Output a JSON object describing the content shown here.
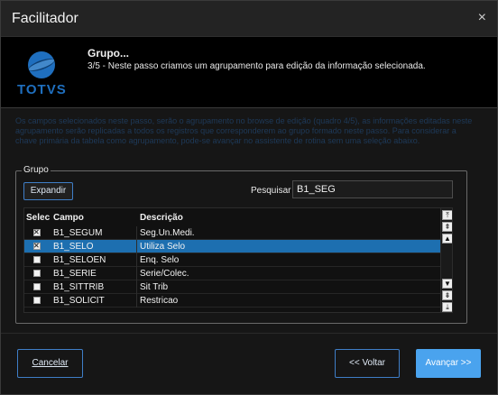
{
  "window": {
    "title": "Facilitador",
    "close_glyph": "×"
  },
  "header": {
    "logo_text": "TOTVS",
    "step_title": "Grupo...",
    "step_desc": "3/5 - Neste passo criamos um agrupamento para edição da informação selecionada."
  },
  "info_text": "Os campos selecionados neste passo, serão o agrupamento no browse de edição (quadro 4/5), as informações editadas neste agrupamento serão replicadas a todos os registros que corresponderem ao grupo formado neste passo. Para considerar a chave primária da tabela como agrupamento, pode-se avançar no assistente de rotina sem uma seleção abaixo.",
  "group": {
    "legend": "Grupo",
    "expand_label": "Expandir",
    "search_label": "Pesquisar",
    "search_value": "B1_SEG",
    "columns": {
      "select": "Selec",
      "field": "Campo",
      "description": "Descrição"
    },
    "rows": [
      {
        "checked": true,
        "field": "B1_SEGUM",
        "description": "Seg.Un.Medi."
      },
      {
        "checked": true,
        "field": "B1_SELO",
        "description": "Utiliza Selo"
      },
      {
        "checked": false,
        "field": "B1_SELOEN",
        "description": "Enq. Selo"
      },
      {
        "checked": false,
        "field": "B1_SERIE",
        "description": "Serie/Colec."
      },
      {
        "checked": false,
        "field": "B1_SITTRIB",
        "description": "Sit Trib"
      },
      {
        "checked": false,
        "field": "B1_SOLICIT",
        "description": "Restricao"
      }
    ],
    "selected_row": 1
  },
  "footer": {
    "cancel_label": "Cancelar",
    "back_label": "<< Voltar",
    "next_label": "Avançar >>"
  },
  "colors": {
    "accent": "#4aa3ee",
    "selection": "#1d6fb0",
    "border_accent": "#3f7ec7"
  }
}
